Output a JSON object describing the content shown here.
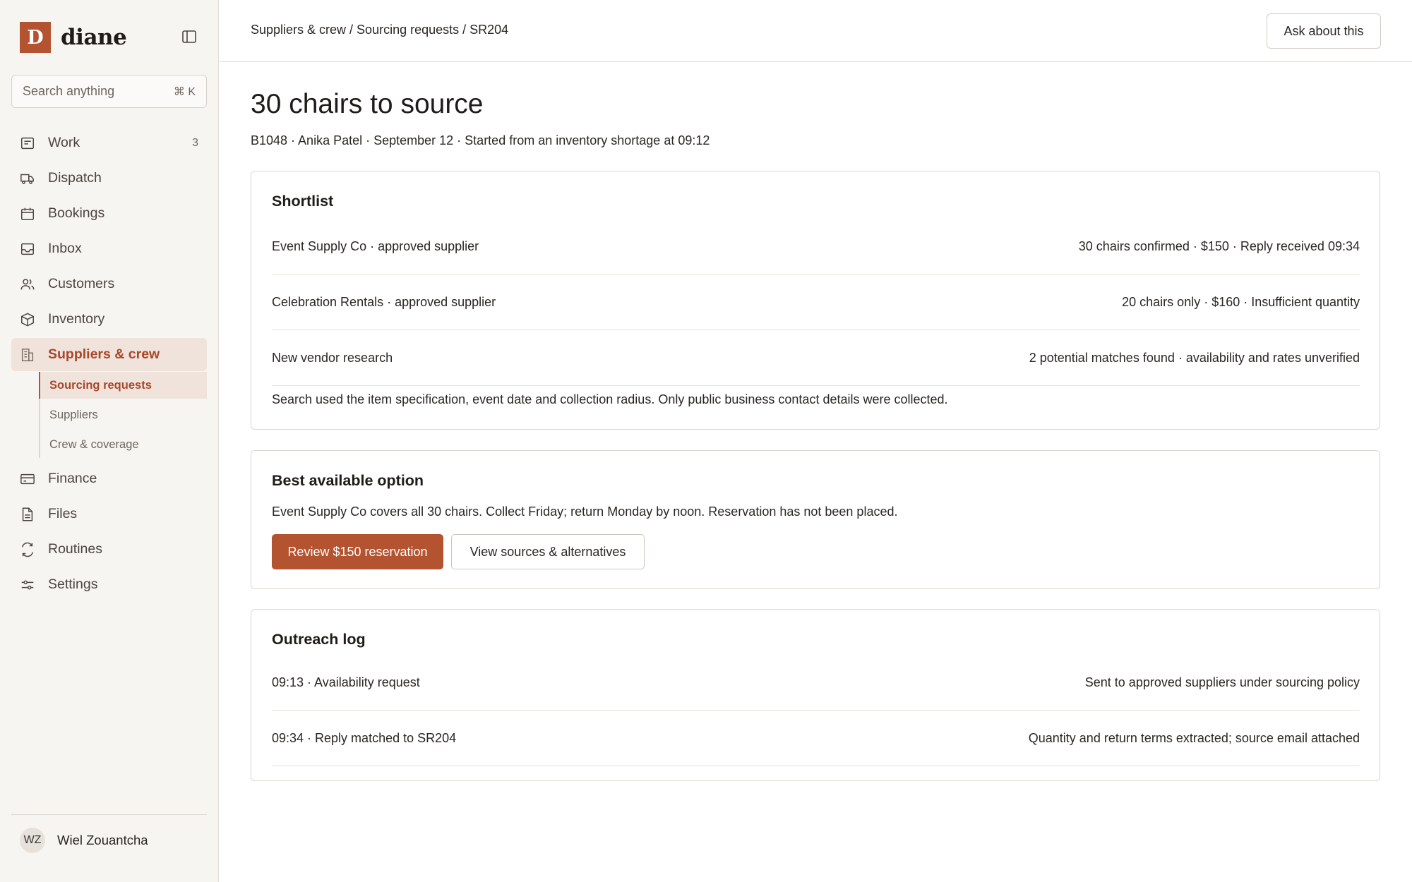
{
  "brand": {
    "logo_letter": "D",
    "name": "diane"
  },
  "search": {
    "placeholder": "Search anything",
    "shortcut": "⌘ K"
  },
  "sidebar": {
    "items": [
      {
        "label": "Work",
        "icon": "work-icon",
        "count": "3"
      },
      {
        "label": "Dispatch",
        "icon": "truck-icon"
      },
      {
        "label": "Bookings",
        "icon": "calendar-icon"
      },
      {
        "label": "Inbox",
        "icon": "inbox-icon"
      },
      {
        "label": "Customers",
        "icon": "users-icon"
      },
      {
        "label": "Inventory",
        "icon": "box-icon"
      },
      {
        "label": "Suppliers & crew",
        "icon": "building-icon",
        "active": true
      },
      {
        "label": "Finance",
        "icon": "credit-card-icon"
      },
      {
        "label": "Files",
        "icon": "file-icon"
      },
      {
        "label": "Routines",
        "icon": "routines-icon"
      },
      {
        "label": "Settings",
        "icon": "sliders-icon"
      }
    ],
    "subitems": [
      {
        "label": "Sourcing requests",
        "active": true
      },
      {
        "label": "Suppliers"
      },
      {
        "label": "Crew & coverage"
      }
    ]
  },
  "user": {
    "initials": "WZ",
    "name": "Wiel Zouantcha"
  },
  "topbar": {
    "breadcrumb": "Suppliers & crew / Sourcing requests / SR204",
    "ask_label": "Ask about this"
  },
  "page": {
    "title": "30 chairs to source",
    "subtitle": "B1048 · Anika Patel · September 12 · Started from an inventory shortage at 09:12"
  },
  "shortlist": {
    "title": "Shortlist",
    "rows": [
      {
        "left": "Event Supply Co · approved supplier",
        "right": "30 chairs confirmed · $150 · Reply received 09:34"
      },
      {
        "left": "Celebration Rentals · approved supplier",
        "right": "20 chairs only · $160 · Insufficient quantity"
      },
      {
        "left": "New vendor research",
        "right": "2 potential matches found · availability and rates unverified"
      }
    ],
    "note": "Search used the item specification, event date and collection radius. Only public business contact details were collected."
  },
  "best_option": {
    "title": "Best available option",
    "text": "Event Supply Co covers all 30 chairs. Collect Friday; return Monday by noon. Reservation has not been placed.",
    "primary_label": "Review $150 reservation",
    "secondary_label": "View sources & alternatives"
  },
  "outreach": {
    "title": "Outreach log",
    "rows": [
      {
        "left": "09:13 · Availability request",
        "right": "Sent to approved suppliers under sourcing policy"
      },
      {
        "left": "09:34 · Reply matched to SR204",
        "right": "Quantity and return terms extracted; source email attached"
      }
    ]
  },
  "colors": {
    "accent": "#b4532f",
    "sidebar_bg": "#f7f5f1",
    "active_bg": "#f0e3dc",
    "active_text": "#a8472a"
  }
}
